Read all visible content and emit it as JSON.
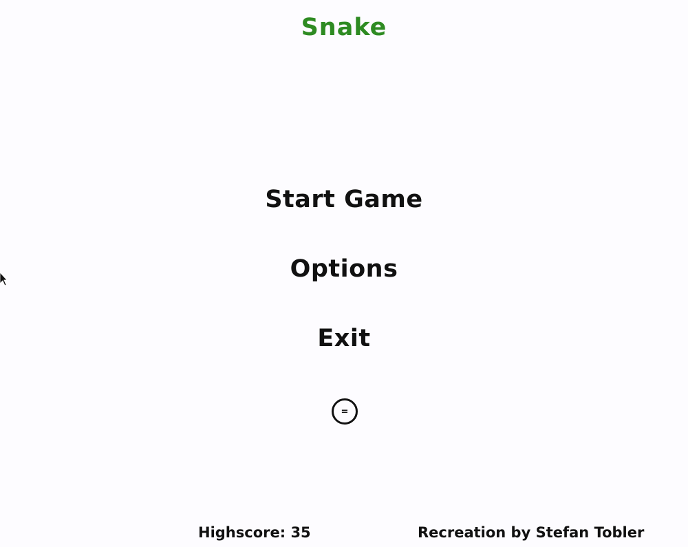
{
  "game": {
    "title": "Snake",
    "title_color": "#2e8b22"
  },
  "menu": {
    "items": [
      {
        "label": "Start Game"
      },
      {
        "label": "Options"
      },
      {
        "label": "Exit"
      }
    ],
    "round_button": {
      "glyph": "=",
      "icon": "equals-circle-icon"
    }
  },
  "footer": {
    "highscore_text": "Highscore: 35",
    "credit_text": "Recreation by Stefan Tobler"
  },
  "background_color": "#fdfcff",
  "cursor_icon": "mouse-pointer-icon"
}
